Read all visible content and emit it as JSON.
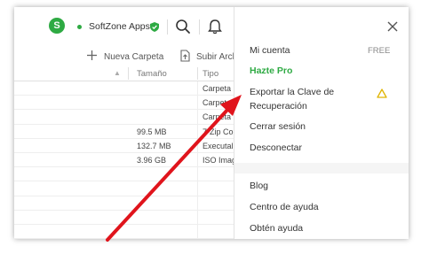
{
  "topbar": {
    "avatar_letter": "S",
    "account_name": "SoftZone Apps",
    "icons": [
      "search-icon",
      "bell-icon",
      "shield-check-icon"
    ]
  },
  "toolbar": {
    "new_folder_label": "Nueva Carpeta",
    "upload_label": "Subir Arch"
  },
  "table": {
    "headers": {
      "size": "Tamaño",
      "type": "Tipo"
    },
    "rows": [
      {
        "size": "",
        "type": "Carpeta"
      },
      {
        "size": "",
        "type": "Carpeta"
      },
      {
        "size": "",
        "type": "Carpeta"
      },
      {
        "size": "99.5 MB",
        "type": "7-Zip Co"
      },
      {
        "size": "132.7 MB",
        "type": "Executal"
      },
      {
        "size": "3.96 GB",
        "type": "ISO Imag"
      },
      {
        "size": "",
        "type": ""
      },
      {
        "size": "",
        "type": ""
      },
      {
        "size": "",
        "type": ""
      },
      {
        "size": "",
        "type": ""
      },
      {
        "size": "",
        "type": ""
      }
    ]
  },
  "menu": {
    "my_account": "Mi cuenta",
    "plan_badge": "FREE",
    "go_pro": "Hazte Pro",
    "export_key": "Exportar la Clave de Recuperación",
    "logout": "Cerrar sesión",
    "disconnect": "Desconectar",
    "blog": "Blog",
    "help_center": "Centro de ayuda",
    "get_help": "Obtén ayuda"
  },
  "colors": {
    "accent_green": "#2eaa43",
    "warning_yellow": "#e0b400",
    "arrow_red": "#e0141c"
  }
}
